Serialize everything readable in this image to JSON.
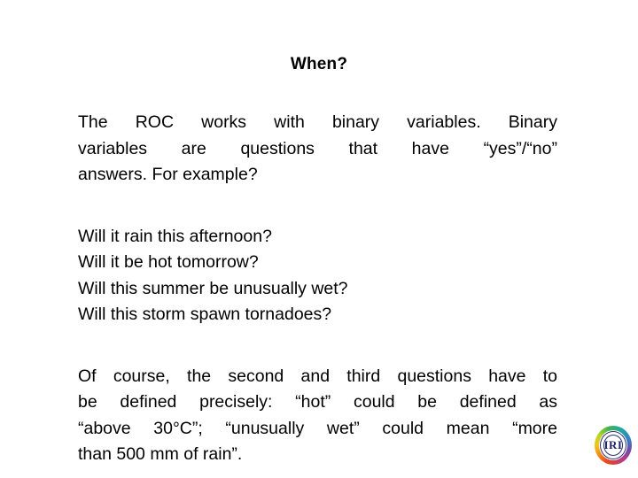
{
  "slide": {
    "title": "When?",
    "background_color": "#ffffff",
    "text_color": "#000000"
  },
  "paragraph_1": {
    "lines": [
      "The ROC works with binary variables. Binary",
      "variables are questions that have “yes”/“no”",
      "answers. For example?"
    ],
    "full_text": "The ROC works with binary variables. Binary variables are questions that have “yes”/“no” answers. For example?"
  },
  "questions": [
    "Will it rain this afternoon?",
    "Will it be hot tomorrow?",
    "Will this summer be unusually wet?",
    "Will this storm spawn tornadoes?"
  ],
  "paragraph_2": {
    "lines": [
      "Of course, the second and third questions have to",
      "be defined precisely: “hot” could be defined as",
      "“above 30°C”; “unusually wet” could mean “more",
      "than 500 mm of rain”."
    ],
    "full_text": "Of course, the second and third questions have to be defined precisely: “hot” could be defined as “above 30°C”; “unusually wet” could mean “more than 500 mm of rain”."
  },
  "logo": {
    "name": "iri-logo",
    "text": "IRI",
    "text_color": "#22246b",
    "ring_colors": [
      "#e8471f",
      "#f08a1c",
      "#f3c41b",
      "#b9d72a",
      "#3fb34f",
      "#22a8a0",
      "#2f86c5",
      "#6b4fa8",
      "#b23a8e"
    ]
  }
}
